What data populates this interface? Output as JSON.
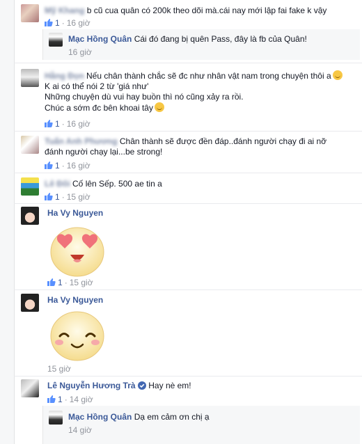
{
  "comments": [
    {
      "author": "Mỹ Khang",
      "text": "b cũ cua quân có 200k theo dõi mà.cái nay mới lập fai fake k vậy",
      "likes": "1",
      "time": "16 giờ"
    },
    {
      "author": "Hằng Đọn",
      "lines": [
        "Nếu chân thành chắc sẽ đc như nhân vật nam trong chuyện thôi a",
        "K ai có thể nói 2 từ 'giá như'",
        "Những chuyện dù vui hay buồn thì nó cũng xảy ra rồi.",
        "Chúc a sớm đc bên khoai tây"
      ],
      "likes": "1",
      "time": "16 giờ"
    },
    {
      "author": "Tuấn Anh Phương",
      "lines": [
        "Chân thành sẽ được đền đáp..đánh người chạy đi ai nỡ",
        "đánh người chạy lại...be strong!"
      ],
      "likes": "1",
      "time": "16 giờ"
    },
    {
      "author": "Lê Đôi",
      "text": "Cố lên Sếp. 500 ae tin a",
      "likes": "1",
      "time": "15 giờ"
    },
    {
      "author": "Ha Vy Nguyen",
      "sticker": "heart-eyes-emoji",
      "likes": "1",
      "time": "15 giờ"
    },
    {
      "author": "Ha Vy Nguyen",
      "sticker": "smiling-emoji",
      "time": "15 giờ"
    },
    {
      "author": "Lê Nguyễn Hương Trà",
      "text": "Hay nè em!",
      "likes": "1",
      "time": "14 giờ"
    }
  ],
  "replies": [
    {
      "author": "Mạc Hồng Quân",
      "text": "Cái đó đang bị quên Pass, đây là fb của Quân!",
      "time": "16 giờ"
    },
    {
      "author": "Mạc Hồng Quân",
      "text": "Dạ em cảm ơn chị ạ",
      "time": "14 giờ"
    }
  ],
  "colors": {
    "link": "#3b5998",
    "meta": "#90949c",
    "reply_bg": "#f6f7f8",
    "verified": "#4267b2"
  }
}
